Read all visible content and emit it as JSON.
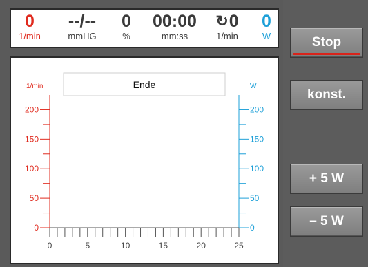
{
  "status": {
    "metrics": [
      {
        "id": "pulse",
        "value": "0",
        "unit": "1/min",
        "color": "red"
      },
      {
        "id": "pressure",
        "value": "--/--",
        "unit": "mmHG",
        "color": "gray"
      },
      {
        "id": "percent",
        "value": "0",
        "unit": "%",
        "color": "gray"
      },
      {
        "id": "time",
        "value": "00:00",
        "unit": "mm:ss",
        "color": "gray"
      },
      {
        "id": "cadence",
        "value": "0",
        "unit": "1/min",
        "color": "gray"
      },
      {
        "id": "power",
        "value": "0",
        "unit": "W",
        "color": "blue"
      }
    ]
  },
  "chart_data": {
    "type": "line",
    "title": "Ende",
    "left_axis": {
      "label": "1/min",
      "ticks": [
        "0",
        "50",
        "100",
        "150",
        "200"
      ],
      "range": [
        0,
        225
      ],
      "color": "#e02b1f"
    },
    "right_axis": {
      "label": "W",
      "ticks": [
        "0",
        "50",
        "100",
        "150",
        "200"
      ],
      "range": [
        0,
        225
      ],
      "color": "#1ea0d8"
    },
    "x_axis": {
      "ticks": [
        "0",
        "5",
        "10",
        "15",
        "20",
        "25"
      ],
      "range": [
        0,
        25
      ]
    },
    "series": []
  },
  "buttons": {
    "stop": "Stop",
    "konst": "konst.",
    "plus": "+ 5 W",
    "minus": "– 5 W"
  },
  "colors": {
    "red": "#e02b1f",
    "blue": "#1ea0d8",
    "gray": "#3a3a3a"
  }
}
